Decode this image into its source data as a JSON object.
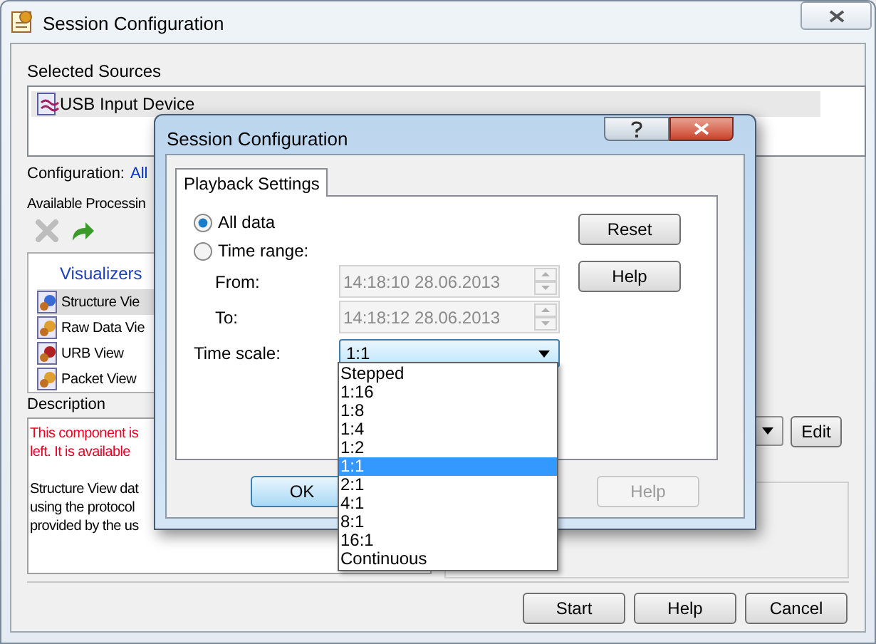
{
  "window": {
    "title": "Session Configuration"
  },
  "selected_sources": {
    "label": "Selected Sources",
    "items": [
      {
        "label": "USB Input Device",
        "selected": true
      }
    ]
  },
  "configuration": {
    "label": "Configuration:",
    "value": "All"
  },
  "available_processing": {
    "label": "Available Processin"
  },
  "visualizers": {
    "title": "Visualizers",
    "items": [
      {
        "label": "Structure Vie",
        "selected": true
      },
      {
        "label": "Raw Data Vie",
        "selected": false
      },
      {
        "label": "URB View",
        "selected": false
      },
      {
        "label": "Packet View",
        "selected": false
      }
    ]
  },
  "description": {
    "label": "Description",
    "warning": [
      "This component is",
      "left. It is available"
    ],
    "text": [
      "Structure View dat",
      "using the protocol",
      "provided by the us"
    ]
  },
  "edit_button": "Edit",
  "buttons": [
    "Start",
    "Help",
    "Cancel"
  ],
  "dialog": {
    "title": "Session Configuration",
    "tabs": [
      {
        "label": "Playback Settings",
        "selected": true
      }
    ],
    "options": [
      {
        "label": "All data",
        "selected": true
      },
      {
        "label": "Time range:",
        "selected": false
      }
    ],
    "from": {
      "label": "From:",
      "value": "14:18:10 28.06.2013",
      "disabled": true
    },
    "to": {
      "label": "To:",
      "value": "14:18:12 28.06.2013",
      "disabled": true
    },
    "time_scale": {
      "label": "Time scale:",
      "value": "1:1",
      "expanded": true,
      "options": [
        {
          "label": "Stepped",
          "selected": false
        },
        {
          "label": "1:16",
          "selected": false
        },
        {
          "label": "1:8",
          "selected": false
        },
        {
          "label": "1:4",
          "selected": false
        },
        {
          "label": "1:2",
          "selected": false
        },
        {
          "label": "1:1",
          "selected": true
        },
        {
          "label": "2:1",
          "selected": false
        },
        {
          "label": "4:1",
          "selected": false
        },
        {
          "label": "8:1",
          "selected": false
        },
        {
          "label": "16:1",
          "selected": false
        },
        {
          "label": "Continuous",
          "selected": false
        }
      ]
    },
    "side_buttons": [
      "Reset",
      "Help"
    ],
    "bottom_buttons": [
      {
        "label": "OK",
        "disabled": false,
        "default": true
      },
      {
        "label": "Help",
        "disabled": true,
        "default": false
      }
    ]
  }
}
